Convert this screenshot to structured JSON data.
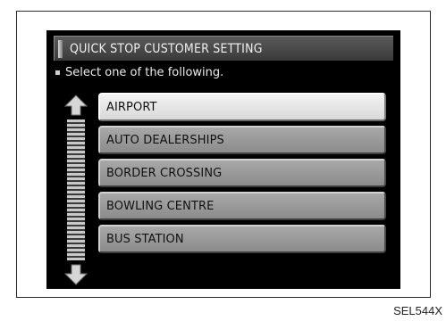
{
  "screen": {
    "title": "QUICK STOP CUSTOMER SETTING",
    "instruction": "Select one of the following.",
    "items": [
      {
        "label": "AIRPORT",
        "selected": true
      },
      {
        "label": "AUTO DEALERSHIPS",
        "selected": false
      },
      {
        "label": "BORDER CROSSING",
        "selected": false
      },
      {
        "label": "BOWLING CENTRE",
        "selected": false
      },
      {
        "label": "BUS STATION",
        "selected": false
      }
    ],
    "scroll_up_icon": "arrow-up-icon",
    "scroll_down_icon": "arrow-down-icon"
  },
  "figure_code": "SEL544X",
  "colors": {
    "screen_background": "#000000",
    "selected_item": "#e6e6e6",
    "item": "#9a9a9a"
  }
}
